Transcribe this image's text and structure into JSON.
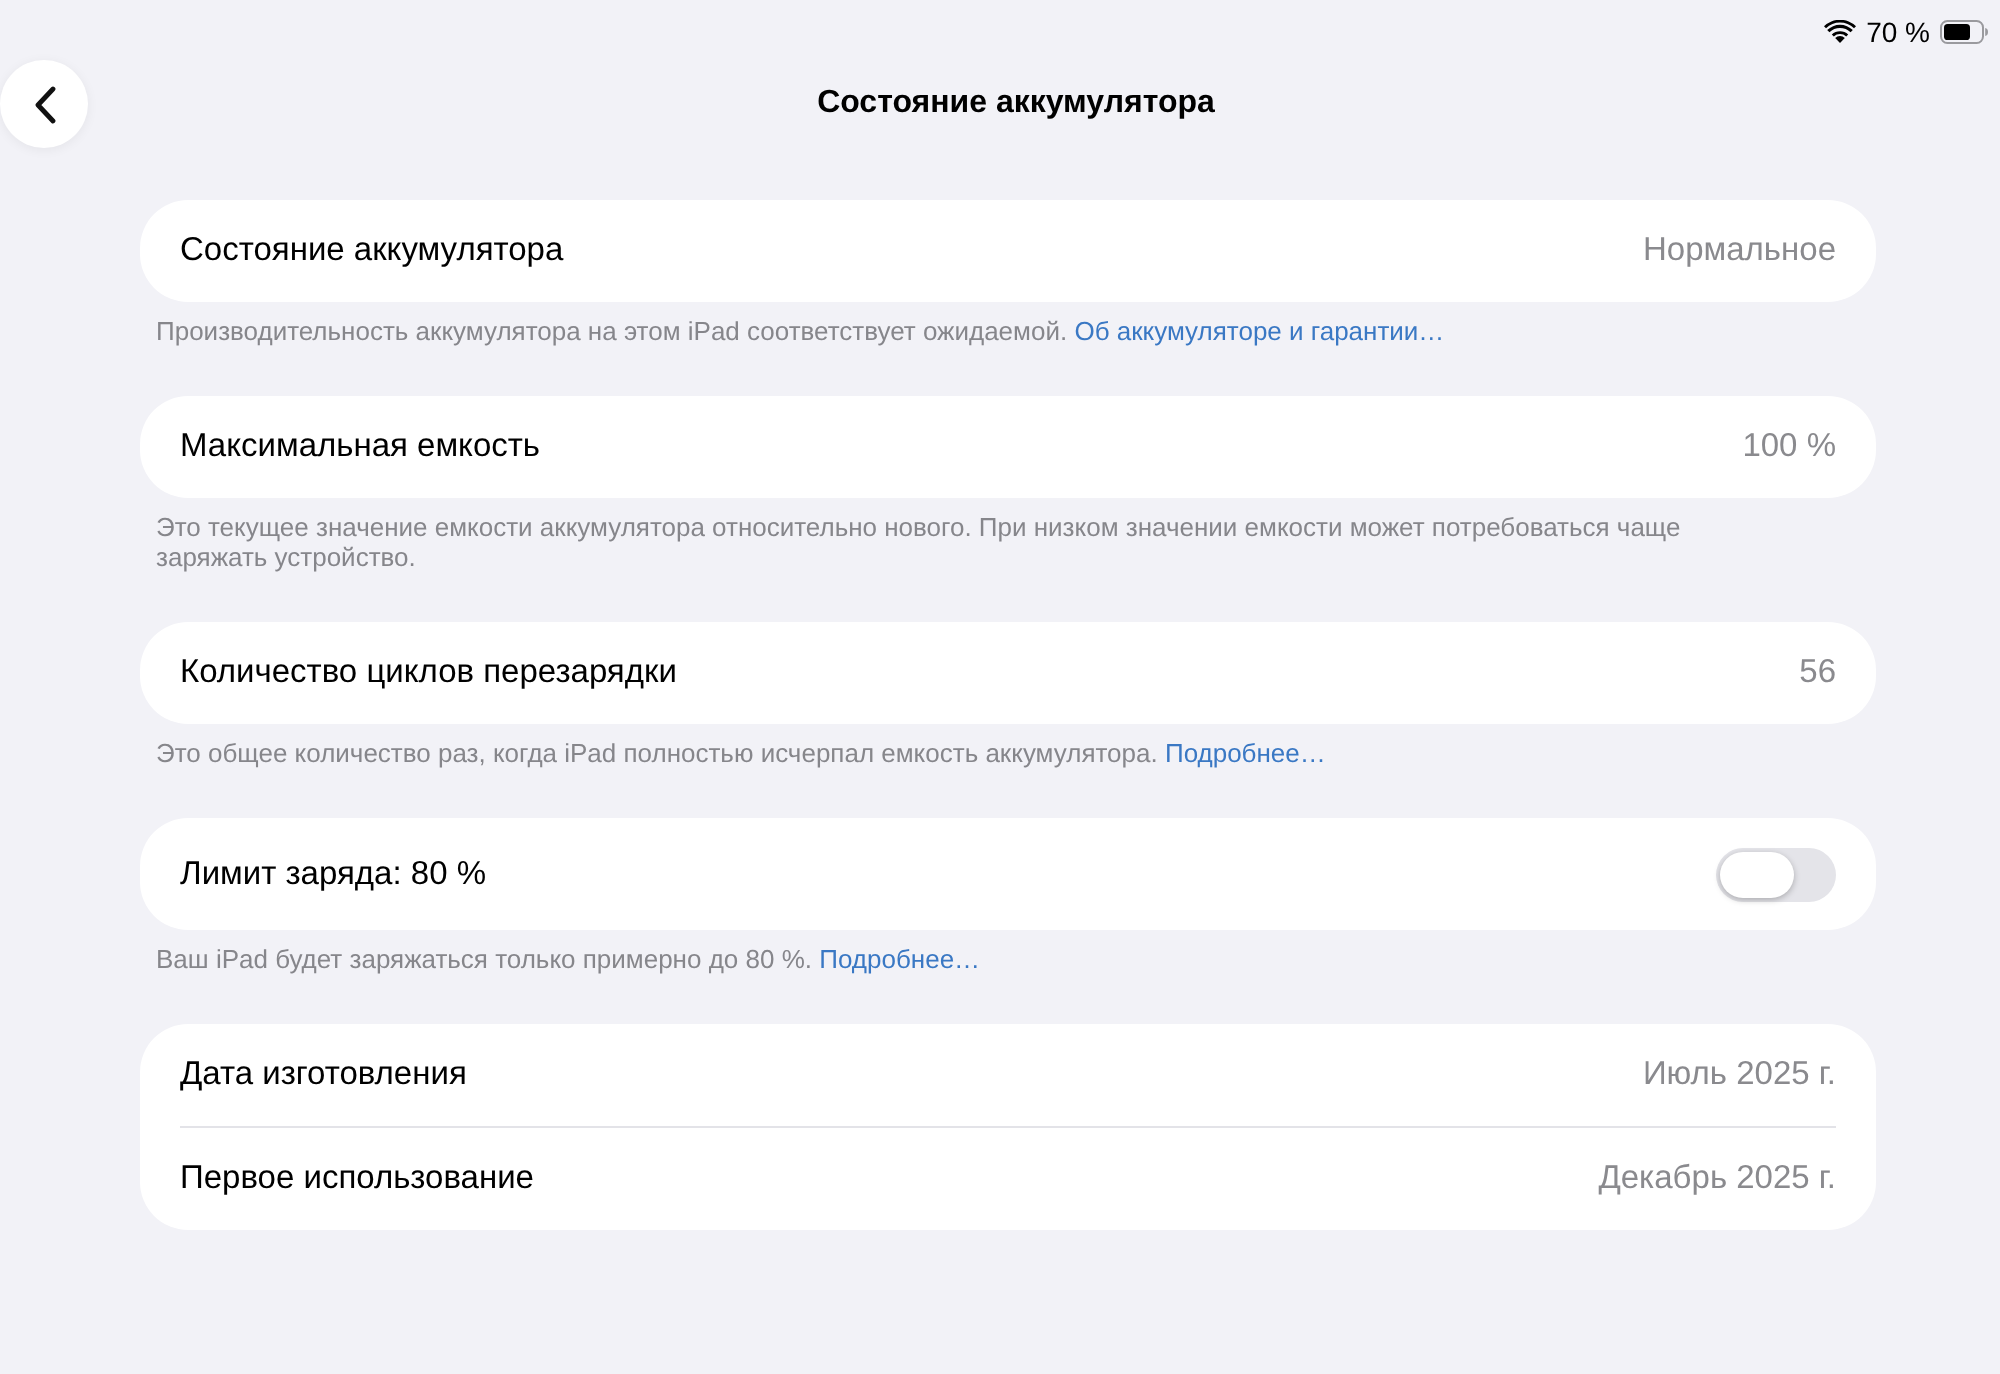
{
  "status_bar": {
    "battery_percent": "70 %"
  },
  "nav": {
    "title": "Состояние аккумулятора"
  },
  "sections": [
    {
      "rows": [
        {
          "kind": "value",
          "label": "Состояние аккумулятора",
          "value": "Нормальное"
        }
      ],
      "footer": {
        "text": "Производительность аккумулятора на этом iPad соответствует ожидаемой.",
        "link": "Об аккумуляторе и гарантии…"
      }
    },
    {
      "rows": [
        {
          "kind": "value",
          "label": "Максимальная емкость",
          "value": "100 %"
        }
      ],
      "footer": {
        "text": "Это текущее значение емкости аккумулятора относительно нового. При низком значении емкости может потребоваться чаще заряжать устройство."
      }
    },
    {
      "rows": [
        {
          "kind": "value",
          "label": "Количество циклов перезарядки",
          "value": "56"
        }
      ],
      "footer": {
        "text": "Это общее количество раз, когда iPad полностью исчерпал емкость аккумулятора.",
        "link": "Подробнее…"
      }
    },
    {
      "rows": [
        {
          "kind": "toggle",
          "label": "Лимит заряда: 80 %",
          "on": false
        }
      ],
      "footer": {
        "text": "Ваш iPad будет заряжаться только примерно до 80 %.",
        "link": "Подробнее…"
      }
    },
    {
      "rows": [
        {
          "kind": "value",
          "label": "Дата изготовления",
          "value": "Июль 2025 г."
        },
        {
          "kind": "value",
          "label": "Первое использование",
          "value": "Декабрь 2025 г."
        }
      ]
    }
  ]
}
